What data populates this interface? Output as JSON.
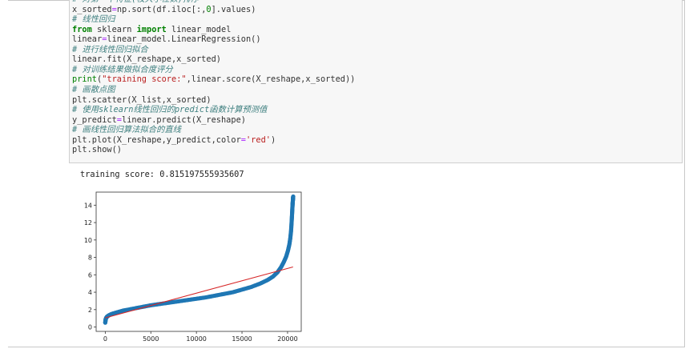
{
  "code_lines": [
    [
      {
        "t": "# 对第一个特征(枝大小任数)排序",
        "c": "cm"
      }
    ],
    [
      {
        "t": "x_sorted",
        "c": ""
      },
      {
        "t": "=",
        "c": "op"
      },
      {
        "t": "np.sort(df.iloc[:,",
        "c": ""
      },
      {
        "t": "0",
        "c": "nm"
      },
      {
        "t": "].values)",
        "c": ""
      }
    ],
    [
      {
        "t": "# 线性回归",
        "c": "cm"
      }
    ],
    [
      {
        "t": "from",
        "c": "kw"
      },
      {
        "t": " sklearn ",
        "c": ""
      },
      {
        "t": "import",
        "c": "kw"
      },
      {
        "t": " linear_model",
        "c": ""
      }
    ],
    [
      {
        "t": "linear",
        "c": ""
      },
      {
        "t": "=",
        "c": "op"
      },
      {
        "t": "linear_model.LinearRegression()",
        "c": ""
      }
    ],
    [
      {
        "t": "# 进行线性回归拟合",
        "c": "cm"
      }
    ],
    [
      {
        "t": "linear.fit(X_reshape,x_sorted)",
        "c": ""
      }
    ],
    [
      {
        "t": "# 对训练结果做拟合度评分",
        "c": "cm"
      }
    ],
    [
      {
        "t": "print",
        "c": "bi"
      },
      {
        "t": "(",
        "c": ""
      },
      {
        "t": "\"training score:\"",
        "c": "st"
      },
      {
        "t": ",linear.score(X_reshape,x_sorted))",
        "c": ""
      }
    ],
    [
      {
        "t": "# 画散点图",
        "c": "cm"
      }
    ],
    [
      {
        "t": "plt.scatter(X_list,x_sorted)",
        "c": ""
      }
    ],
    [
      {
        "t": "# 使用sklearn线性回归的predict函数计算预测值",
        "c": "cm"
      }
    ],
    [
      {
        "t": "y_predict",
        "c": ""
      },
      {
        "t": "=",
        "c": "op"
      },
      {
        "t": "linear.predict(X_reshape)",
        "c": ""
      }
    ],
    [
      {
        "t": "# 画线性回归算法拟合的直线",
        "c": "cm"
      }
    ],
    [
      {
        "t": "plt.plot(X_reshape,y_predict,color",
        "c": ""
      },
      {
        "t": "=",
        "c": "op"
      },
      {
        "t": "'red'",
        "c": "st"
      },
      {
        "t": ")",
        "c": ""
      }
    ],
    [
      {
        "t": "plt.show()",
        "c": ""
      }
    ]
  ],
  "output": {
    "score_text": "training score: 0.815197555935607"
  },
  "colors": {
    "cell_accent": "#42a5f5",
    "scatter": "#1f77b4",
    "fit_line": "#d62728"
  },
  "chart_data": {
    "type": "scatter",
    "xlim": [
      -1000,
      21500
    ],
    "ylim": [
      -0.5,
      15.5
    ],
    "x_ticks": [
      0,
      5000,
      10000,
      15000,
      20000
    ],
    "y_ticks": [
      0,
      2,
      4,
      6,
      8,
      10,
      12,
      14
    ],
    "x_tick_labels": [
      "0",
      "5000",
      "10000",
      "15000",
      "20000"
    ],
    "y_tick_labels": [
      "0",
      "2",
      "4",
      "6",
      "8",
      "10",
      "12",
      "14"
    ],
    "grid": false,
    "series": [
      {
        "kind": "scatter",
        "x": [
          0,
          20,
          50,
          100,
          200,
          400,
          700,
          1000,
          1500,
          2000,
          3000,
          4000,
          5000,
          6000,
          7000,
          8000,
          9000,
          10000,
          11000,
          12000,
          13000,
          14000,
          15000,
          16000,
          17000,
          17800,
          18400,
          18900,
          19300,
          19600,
          19850,
          20050,
          20200,
          20300,
          20380,
          20430,
          20470,
          20500,
          20530,
          20550,
          20580,
          20600,
          20620
        ],
        "y": [
          0.5,
          0.7,
          0.9,
          1.05,
          1.2,
          1.35,
          1.5,
          1.6,
          1.75,
          1.9,
          2.1,
          2.3,
          2.5,
          2.65,
          2.8,
          2.95,
          3.1,
          3.25,
          3.4,
          3.6,
          3.8,
          4.0,
          4.3,
          4.6,
          5.0,
          5.4,
          5.8,
          6.3,
          6.9,
          7.5,
          8.1,
          8.8,
          9.5,
          10.2,
          11.0,
          11.8,
          12.5,
          13.1,
          13.7,
          14.1,
          14.5,
          14.8,
          15.0
        ]
      },
      {
        "kind": "line",
        "x": [
          0,
          20600
        ],
        "y": [
          1.05,
          6.9
        ]
      }
    ]
  }
}
